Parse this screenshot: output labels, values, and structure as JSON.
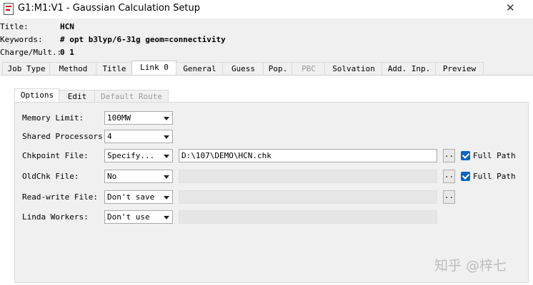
{
  "window": {
    "title": "G1:M1:V1 - Gaussian Calculation Setup",
    "close_glyph": "✕",
    "icon": "document-icon"
  },
  "header": {
    "title_label": "Title:",
    "title_value": "HCN",
    "keywords_label": "Keywords:",
    "keywords_value": "# opt b3lyp/6-31g geom=connectivity",
    "charge_label": "Charge/Mult.:",
    "charge_value": "0 1"
  },
  "tabs": [
    {
      "label": "Job Type"
    },
    {
      "label": "Method"
    },
    {
      "label": "Title"
    },
    {
      "label": "Link 0",
      "active": true
    },
    {
      "label": "General"
    },
    {
      "label": "Guess"
    },
    {
      "label": "Pop."
    },
    {
      "label": "PBC",
      "disabled": true
    },
    {
      "label": "Solvation"
    },
    {
      "label": "Add. Inp."
    },
    {
      "label": "Preview"
    }
  ],
  "subtabs": [
    {
      "label": "Options",
      "active": true
    },
    {
      "label": "Edit"
    },
    {
      "label": "Default Route",
      "disabled": true
    }
  ],
  "fields": {
    "memory_limit": {
      "label": "Memory Limit:",
      "value": "100MW"
    },
    "shared_processors": {
      "label": "Shared Processors:",
      "value": "4"
    },
    "chkpoint_file": {
      "label": "Chkpoint File:",
      "mode": "Specify...",
      "path": "D:\\107\\DEMO\\HCN.chk",
      "full_path_label": "Full Path",
      "full_path_checked": true
    },
    "oldchk_file": {
      "label": "OldChk File:",
      "mode": "No",
      "path": "",
      "full_path_label": "Full Path",
      "full_path_checked": true
    },
    "readwrite_file": {
      "label": "Read-write File:",
      "mode": "Don't save",
      "path": ""
    },
    "linda_workers": {
      "label": "Linda Workers:",
      "mode": "Don't use",
      "path": ""
    }
  },
  "browse_label": "..",
  "watermark": "知乎 @梓七"
}
